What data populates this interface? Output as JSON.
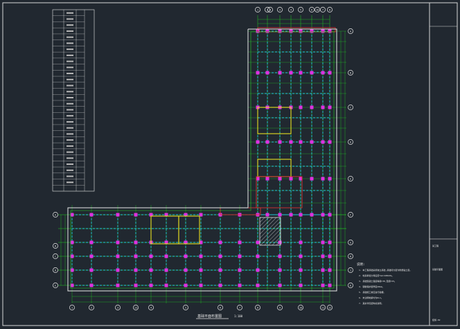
{
  "drawing": {
    "plan_title": "基础平面布置图",
    "scale_text": "1:100",
    "top_axis_labels": [
      "1",
      "2",
      "3",
      "4",
      "5",
      "6",
      "7",
      "8",
      "9",
      "10"
    ],
    "right_axis_labels": [
      "A",
      "B",
      "C",
      "D",
      "E",
      "F",
      "G",
      "H",
      "J",
      "K"
    ],
    "left_axis_labels": [
      "A",
      "B",
      "C",
      "D",
      "E"
    ],
    "bottom_axis_labels": [
      "1",
      "2",
      "3",
      "4",
      "5",
      "6",
      "7",
      "8",
      "9",
      "10",
      "11",
      "12",
      "13"
    ]
  },
  "notes": {
    "heading": "说明:",
    "items": [
      "1. 本工程基础采用独立基础,基础持力层为粉质粘土层。",
      "2. 地基承载力特征值fak=180kPa。",
      "3. 基础混凝土强度等级C30,垫层C15。",
      "4. 钢筋保护层厚度40mm。",
      "5. 基础施工前应进行验槽。",
      "6. 未注明地梁均为DL1。",
      "7. 其余详见结构总说明。"
    ]
  },
  "schedule": {
    "title": "基础表",
    "row_count": 30
  },
  "title_block": {
    "project": "某工程",
    "drawing_name": "基础平面图",
    "drawing_no": "结施-02"
  },
  "colors": {
    "background": "#212830",
    "cad_white": "#e8e8e8",
    "axis_green": "#22cc22",
    "beam_cyan": "#22c8d8",
    "column_magenta": "#e030e0",
    "wall_yellow": "#e8e020",
    "pit_red": "#d83030"
  }
}
